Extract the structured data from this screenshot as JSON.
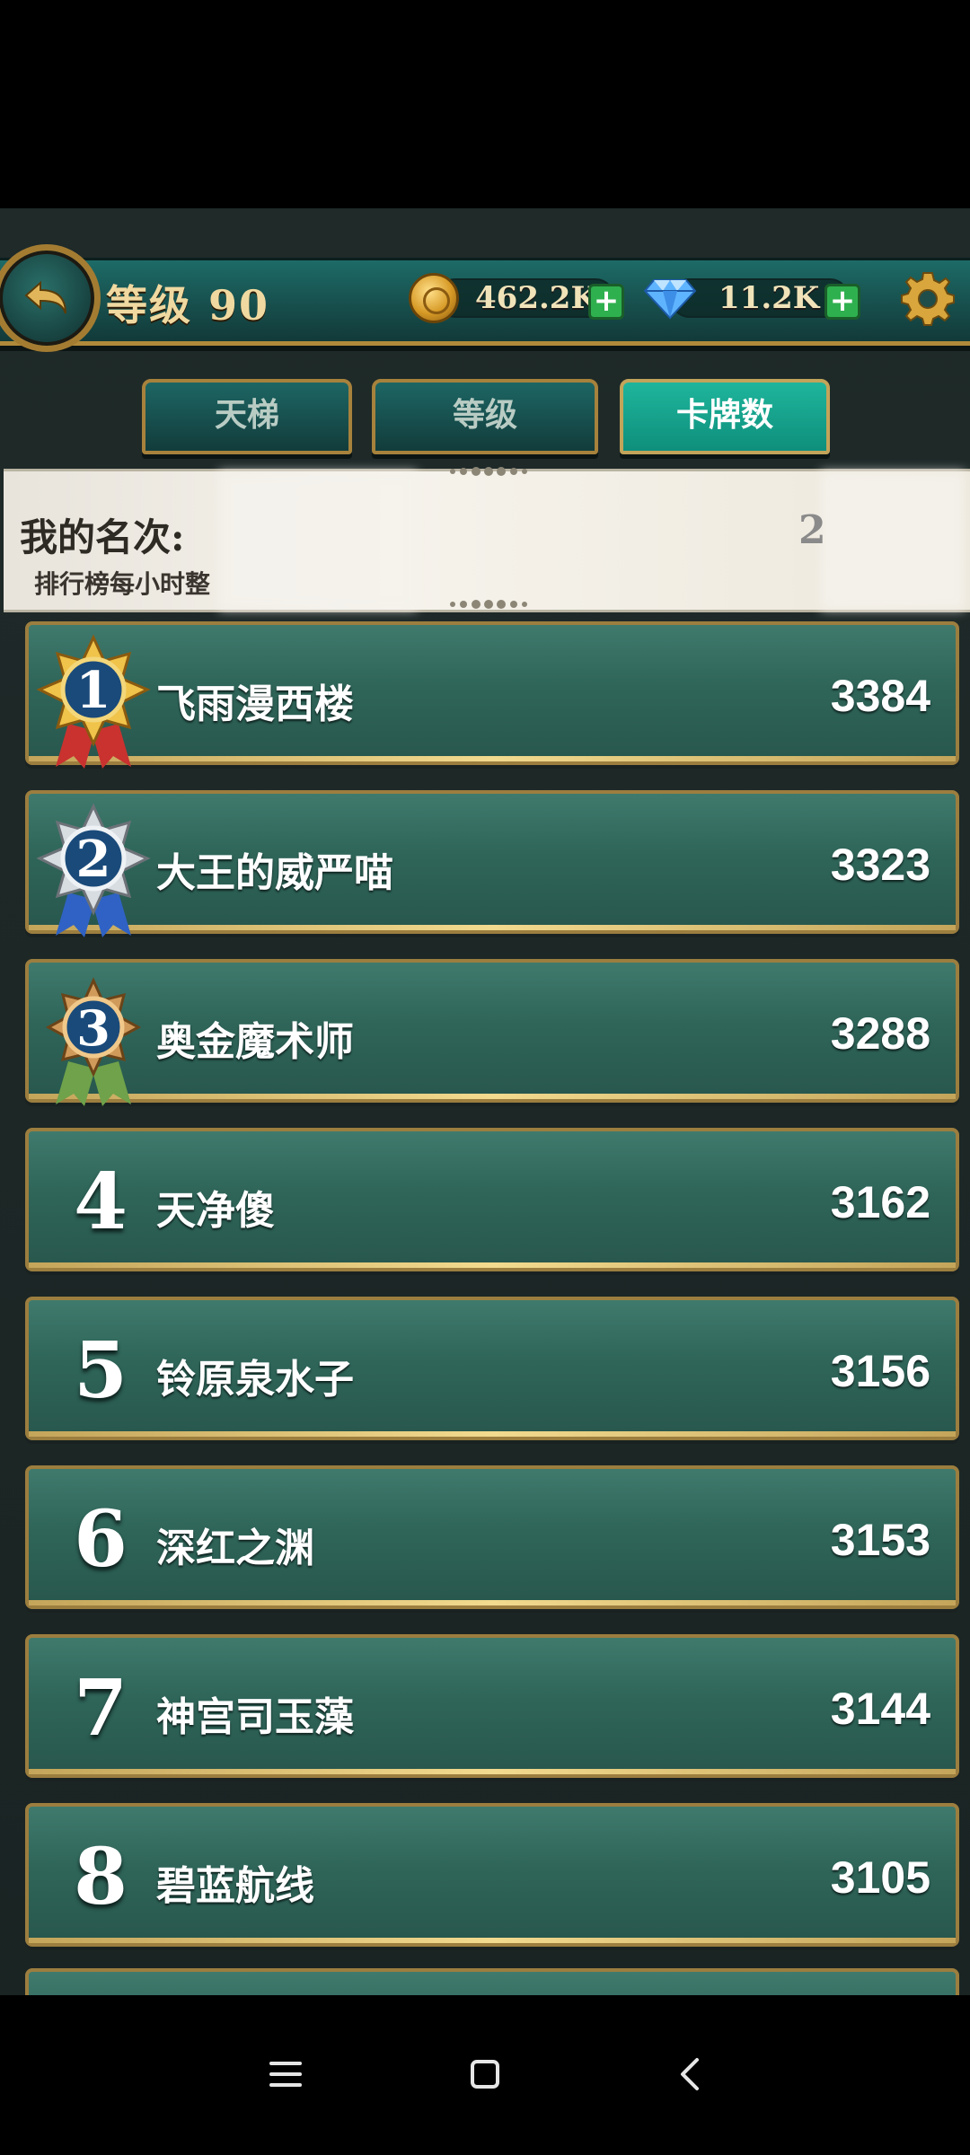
{
  "header": {
    "level_label": "等级 90",
    "coins": "462.2K",
    "gems": "11.2K",
    "plus": "+"
  },
  "tabs": [
    {
      "label": "天梯",
      "active": false
    },
    {
      "label": "等级",
      "active": false
    },
    {
      "label": "卡牌数",
      "active": true
    }
  ],
  "my_rank": {
    "label": "我的名次:",
    "value": "2",
    "note": "排行榜每小时整"
  },
  "leaderboard": [
    {
      "rank": "1",
      "name": "飞雨漫西楼",
      "score": "3384",
      "medal": "gold"
    },
    {
      "rank": "2",
      "name": "大王的威严喵",
      "score": "3323",
      "medal": "silver"
    },
    {
      "rank": "3",
      "name": "奥金魔术师",
      "score": "3288",
      "medal": "bronze"
    },
    {
      "rank": "4",
      "name": "天净傻",
      "score": "3162"
    },
    {
      "rank": "5",
      "name": "铃原泉水子",
      "score": "3156"
    },
    {
      "rank": "6",
      "name": "深红之渊",
      "score": "3153"
    },
    {
      "rank": "7",
      "name": "神宫司玉藻",
      "score": "3144"
    },
    {
      "rank": "8",
      "name": "碧蓝航线",
      "score": "3105"
    }
  ],
  "nav": {
    "icons": [
      "menu-icon",
      "home-icon",
      "back-icon"
    ]
  }
}
